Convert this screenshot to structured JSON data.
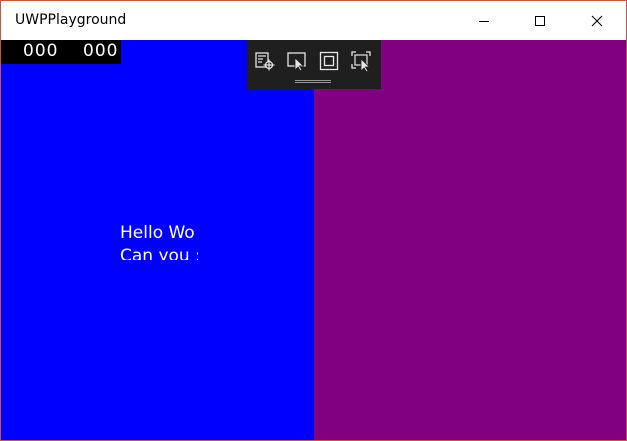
{
  "window": {
    "title": "UWPPlayground"
  },
  "caption_buttons": {
    "minimize_icon": "minimize-icon",
    "maximize_icon": "maximize-icon",
    "close_icon": "close-icon"
  },
  "colors": {
    "left_pane": "#0000ff",
    "right_pane": "#800080",
    "frame_border": "#c9543f",
    "devtools_bg": "#1f1f1f"
  },
  "content": {
    "text_line_1": "Hello Wo",
    "text_line_2": "Can you :"
  },
  "frame_counter": {
    "value_1": "000",
    "value_2": "000"
  },
  "debug_toolbar": {
    "icons": [
      "live-visual-tree-icon",
      "select-element-icon",
      "display-layout-adorners-icon",
      "track-focused-element-icon"
    ]
  }
}
